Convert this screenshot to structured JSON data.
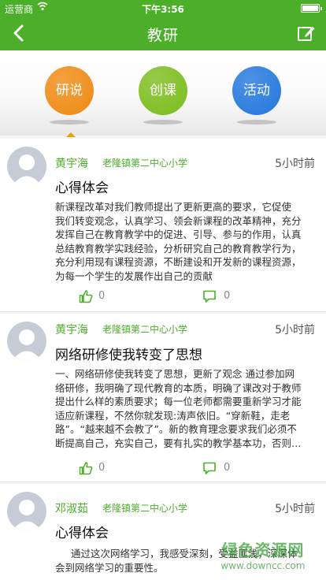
{
  "status_bar": {
    "carrier": "运营商",
    "time": "下午3:56",
    "battery_level": 1.0
  },
  "nav": {
    "title": "教研"
  },
  "categories": [
    {
      "label": "研说",
      "color": "#f08a12"
    },
    {
      "label": "创课",
      "color": "#7cbd1c"
    },
    {
      "label": "活动",
      "color": "#2277dd"
    }
  ],
  "colors": {
    "brand": "#4caf2a"
  },
  "posts": [
    {
      "author": "黄宇海",
      "school": "老隆镇第二中心小学",
      "time_ago": "5小时前",
      "title": "心得体会",
      "lines": [
        "新课程改革对我们教师提出了更新更高的要求，它促使",
        "我们转变观念，认真学习、领会新课程的改革精神，充分",
        "发挥自己在教育教学中的促进、引导、参与的作用，认真",
        "总结教育教学实践经验，分析研究自己的教育教学行为，",
        "充分利用现有课程资源，不断建设和开发新的课程资源，",
        "为每一个学生的发展作出自己的贡献"
      ],
      "likes": "0",
      "comments": "0"
    },
    {
      "author": "黄宇海",
      "school": "老隆镇第二中心小学",
      "time_ago": "5小时前",
      "title": "网络研修使我转变了思想",
      "lines": [
        "一、网络研修使我转变了思想，更新了观念 通过参加网",
        "络研修，我明确了现代教育的本质，明确了课改对于教师",
        "提出什么样的素质要求；每一位老师都需要重新学习才能",
        "适应新课程，不然你就发现:涛声依旧。“穿新鞋，走老",
        "路”。“越来越不会教了”。新的教育理念要求我们必须不",
        "断提高自己，充实自己，要有扎实的教学基本功，否则…"
      ],
      "likes": "0",
      "comments": "0"
    },
    {
      "author": "邓淑茹",
      "school": "老隆镇第二中心小学",
      "time_ago": "5小时前",
      "title": "心得体会",
      "lines": [
        "通过这次网络学习，我感受深刻，受益匪浅，深深体",
        "会到网络学习的重要性。"
      ],
      "likes": "",
      "comments": ""
    }
  ],
  "watermark": {
    "cn": "绿色资源网",
    "url": "www.downcc.com"
  }
}
